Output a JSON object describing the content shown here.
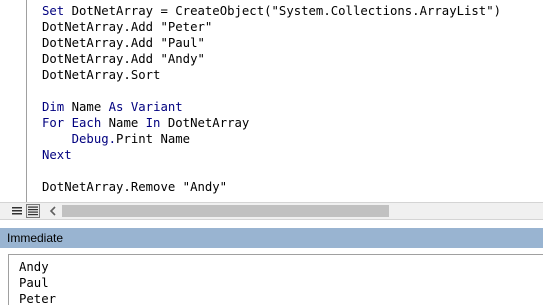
{
  "code_editor": {
    "lines": [
      [
        {
          "t": "Set",
          "kw": true
        },
        {
          "t": " DotNetArray = CreateObject(\"System.Collections.ArrayList\")",
          "kw": false
        }
      ],
      [
        {
          "t": "DotNetArray.Add \"Peter\"",
          "kw": false
        }
      ],
      [
        {
          "t": "DotNetArray.Add \"Paul\"",
          "kw": false
        }
      ],
      [
        {
          "t": "DotNetArray.Add \"Andy\"",
          "kw": false
        }
      ],
      [
        {
          "t": "DotNetArray.Sort",
          "kw": false
        }
      ],
      [
        {
          "t": "",
          "kw": false
        }
      ],
      [
        {
          "t": "Dim",
          "kw": true
        },
        {
          "t": " Name ",
          "kw": false
        },
        {
          "t": "As",
          "kw": true
        },
        {
          "t": " Variant",
          "kw": true
        }
      ],
      [
        {
          "t": "For Each",
          "kw": true
        },
        {
          "t": " Name ",
          "kw": false
        },
        {
          "t": "In",
          "kw": true
        },
        {
          "t": " DotNetArray",
          "kw": false
        }
      ],
      [
        {
          "t": "    Debug.",
          "kw": true
        },
        {
          "t": "Print Name",
          "kw": false
        }
      ],
      [
        {
          "t": "Next",
          "kw": true
        }
      ],
      [
        {
          "t": "",
          "kw": false
        }
      ],
      [
        {
          "t": "DotNetArray.Remove \"Andy\"",
          "kw": false
        }
      ]
    ],
    "keyword_color": "#00007f",
    "text_color": "#000000"
  },
  "scrollbar": {
    "left_arrow_icon": "chevron-left-icon",
    "thumb_fraction": 0.68
  },
  "view_buttons": {
    "procedure_view_icon": "procedure-view-icon",
    "full_module_view_icon": "full-module-view-icon"
  },
  "immediate_window": {
    "title": "Immediate",
    "title_bar_color": "#99b4d1",
    "output_lines": [
      "Andy",
      "Paul",
      "Peter"
    ]
  }
}
